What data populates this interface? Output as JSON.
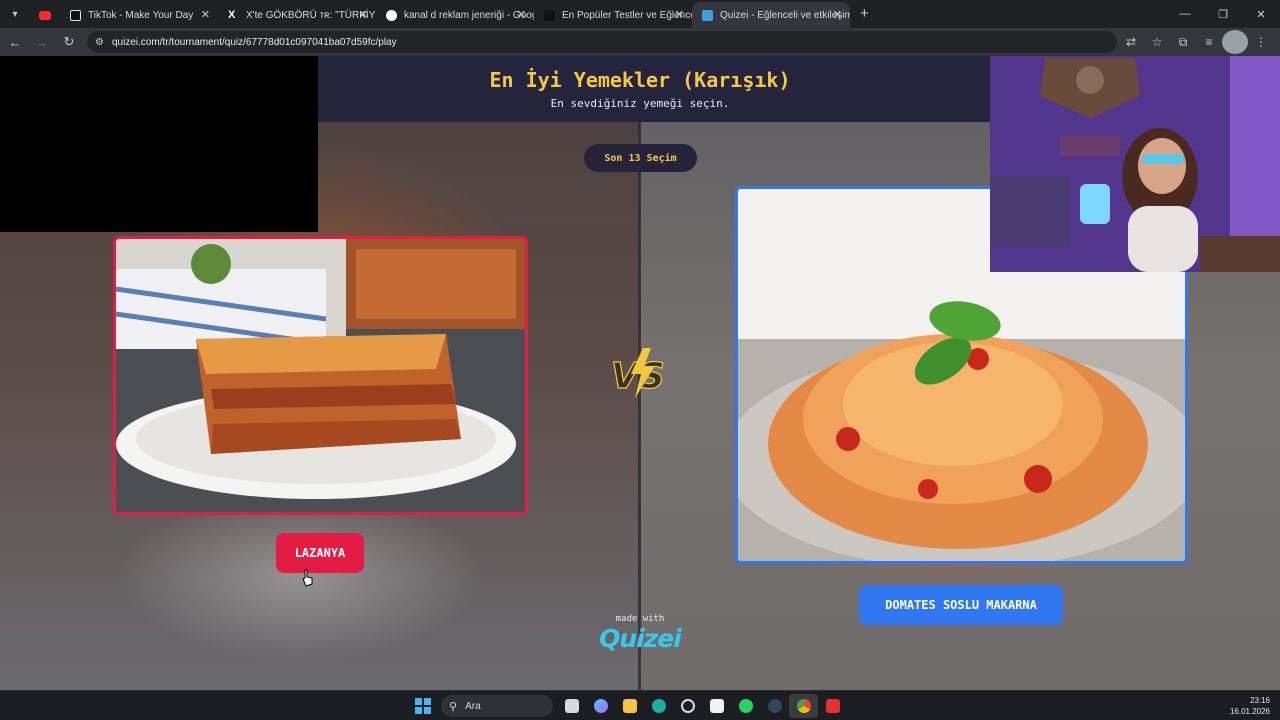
{
  "browser": {
    "tabs": [
      {
        "label": "",
        "favicon": "youtube-icon",
        "active": false
      },
      {
        "label": "TikTok - Make Your Day",
        "favicon": "tiktok-icon",
        "active": false
      },
      {
        "label": "X'te GÖKBÖRÜ ᴛʀ: \"TÜRKİYE TÜ",
        "favicon": "x-icon",
        "active": false
      },
      {
        "label": "kanal d reklam jeneriği - Googl",
        "favicon": "google-icon",
        "active": false
      },
      {
        "label": "En Popüler Testler ve Eğlenceli",
        "favicon": "site-icon",
        "active": false
      },
      {
        "label": "Quizei - Eğlenceli ve etkileşimli",
        "favicon": "quizei-icon",
        "active": true
      }
    ],
    "url": "quizei.com/tr/tournament/quiz/67778d01c097041ba07d59fc/play"
  },
  "quiz": {
    "title": "En İyi Yemekler (Karışık)",
    "subtitle": "En sevdiğiniz yemeği seçin.",
    "round_label": "Son 13 Seçim",
    "left_option": {
      "label": "LAZANYA",
      "accent": "#e41b43"
    },
    "right_option": {
      "label": "DOMATES SOSLU MAKARNA",
      "accent": "#2f78f2"
    },
    "vs_label": "VS",
    "made_with": "made with",
    "brand": "Quizei"
  },
  "taskbar": {
    "search_placeholder": "Ara",
    "time": "23:16",
    "date": "16.01.2026"
  },
  "colors": {
    "title": "#f6c842",
    "header_bg": "#25243d",
    "brand": "#37c9ea"
  }
}
